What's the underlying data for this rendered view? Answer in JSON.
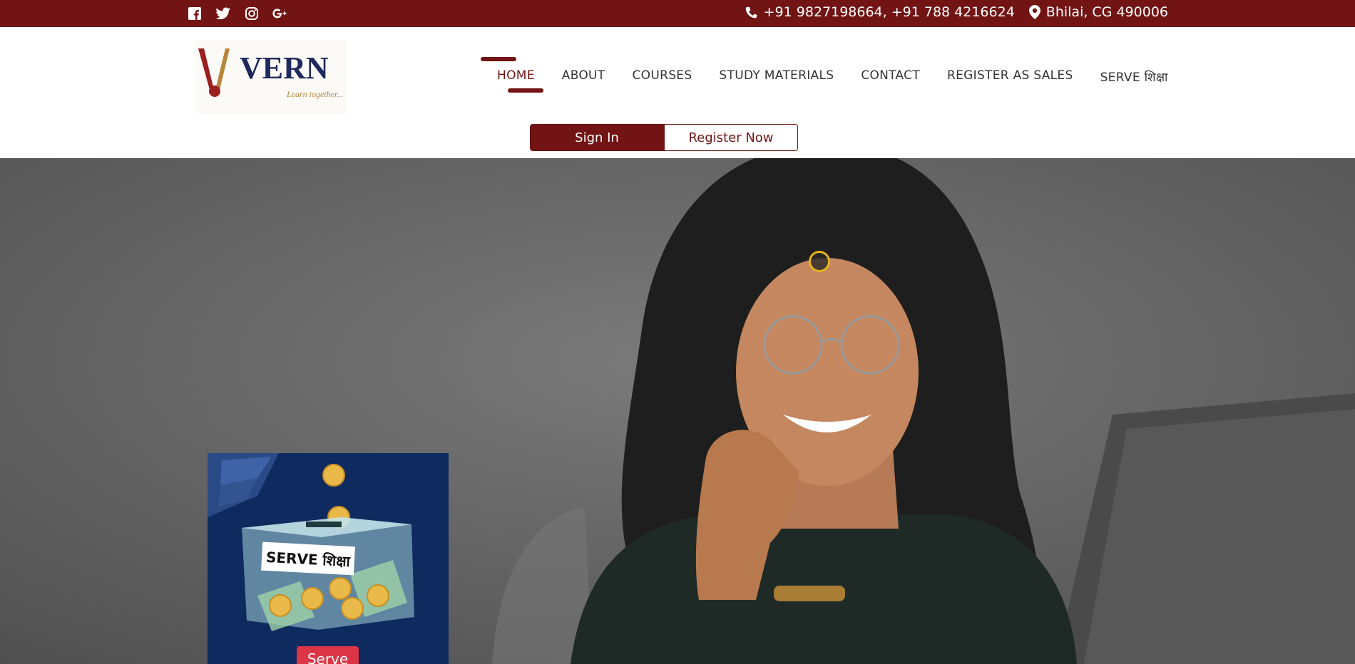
{
  "topbar": {
    "social_icons": [
      "facebook-icon",
      "twitter-icon",
      "instagram-icon",
      "google-plus-icon"
    ],
    "phone_icon": "phone-icon",
    "phones": "+91 9827198664, +91 788 4216624",
    "location_icon": "map-marker-icon",
    "address": "Bhilai, CG 490006"
  },
  "logo": {
    "brand": "VERN",
    "tagline": "Learn together..."
  },
  "nav": {
    "items": [
      {
        "label": "HOME"
      },
      {
        "label": "ABOUT"
      },
      {
        "label": "COURSES"
      },
      {
        "label": "STUDY MATERIALS"
      },
      {
        "label": "CONTACT"
      },
      {
        "label": "REGISTER AS SALES"
      },
      {
        "label": "SERVE शिक्षा"
      }
    ],
    "active": "HOME"
  },
  "auth": {
    "signin_label": "Sign In",
    "register_label": "Register Now"
  },
  "serve_card": {
    "box_label": "SERVE शिक्षा",
    "button_label": "Serve"
  },
  "colors": {
    "brand": "#721414",
    "serve_card_bg": "#0e2a5e",
    "serve_button": "#dc3545",
    "coin": "#e9b949"
  }
}
